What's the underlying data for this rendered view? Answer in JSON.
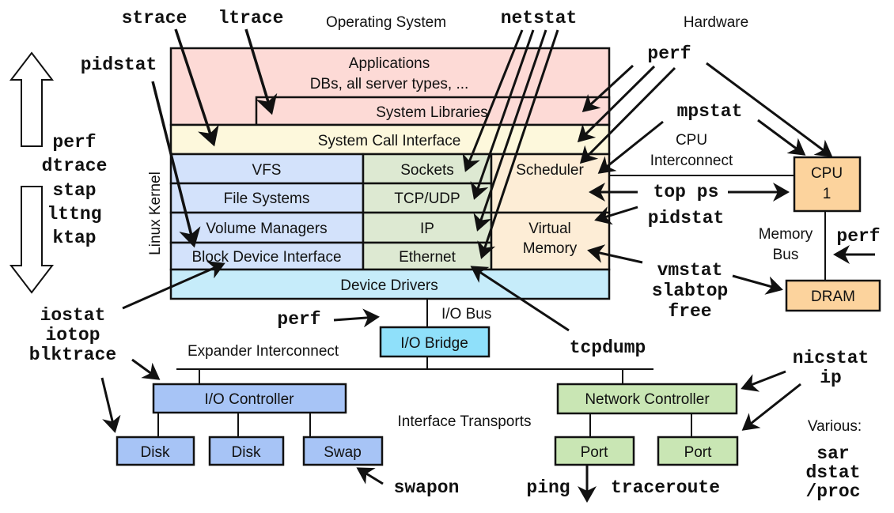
{
  "headers": {
    "os": "Operating System",
    "hardware": "Hardware",
    "kernel": "Linux Kernel"
  },
  "layers": {
    "applications": "Applications",
    "applications_sub": "DBs, all server types, ...",
    "system_libraries": "System Libraries",
    "syscall": "System Call Interface",
    "vfs": "VFS",
    "file_systems": "File Systems",
    "volume_managers": "Volume Managers",
    "block_device": "Block Device Interface",
    "sockets": "Sockets",
    "tcp_udp": "TCP/UDP",
    "ip": "IP",
    "ethernet": "Ethernet",
    "scheduler": "Scheduler",
    "virtual": "Virtual",
    "memory": "Memory",
    "device_drivers": "Device Drivers"
  },
  "hardware": {
    "cpu": "CPU",
    "cpu_num": "1",
    "dram": "DRAM",
    "cpu_interconnect_1": "CPU",
    "cpu_interconnect_2": "Interconnect",
    "memory_bus_1": "Memory",
    "memory_bus_2": "Bus",
    "io_bus": "I/O Bus",
    "io_bridge": "I/O Bridge",
    "expander": "Expander Interconnect",
    "io_controller": "I/O Controller",
    "disk1": "Disk",
    "disk2": "Disk",
    "swap": "Swap",
    "interface_transports": "Interface Transports",
    "network_controller": "Network Controller",
    "port1": "Port",
    "port2": "Port",
    "various": "Various:"
  },
  "tools": {
    "strace": "strace",
    "ltrace": "ltrace",
    "netstat": "netstat",
    "pidstat_top": "pidstat",
    "perf_top": "perf",
    "mpstat": "mpstat",
    "top_ps": "top ps",
    "pidstat_right": "pidstat",
    "perf_membus": "perf",
    "vmstat": "vmstat",
    "slabtop": "slabtop",
    "free": "free",
    "tracers": [
      "perf",
      "dtrace",
      "stap",
      "lttng",
      "ktap"
    ],
    "iostat": "iostat",
    "iotop": "iotop",
    "blktrace": "blktrace",
    "perf_iobus": "perf",
    "tcpdump": "tcpdump",
    "nicstat": "nicstat",
    "ip": "ip",
    "swapon": "swapon",
    "ping": "ping",
    "traceroute": "traceroute",
    "various": [
      "sar",
      "dstat",
      "/proc"
    ]
  },
  "colors": {
    "app": "#fddad6",
    "syscall": "#fdf8dc",
    "fs": "#d3e2fb",
    "net": "#dde9d2",
    "sched": "#fdedd6",
    "drivers": "#c6ecfa",
    "cpu": "#fcd39d",
    "bridge": "#8fe0fa",
    "ioctl": "#a7c4f6",
    "nic": "#c9e6b4"
  }
}
